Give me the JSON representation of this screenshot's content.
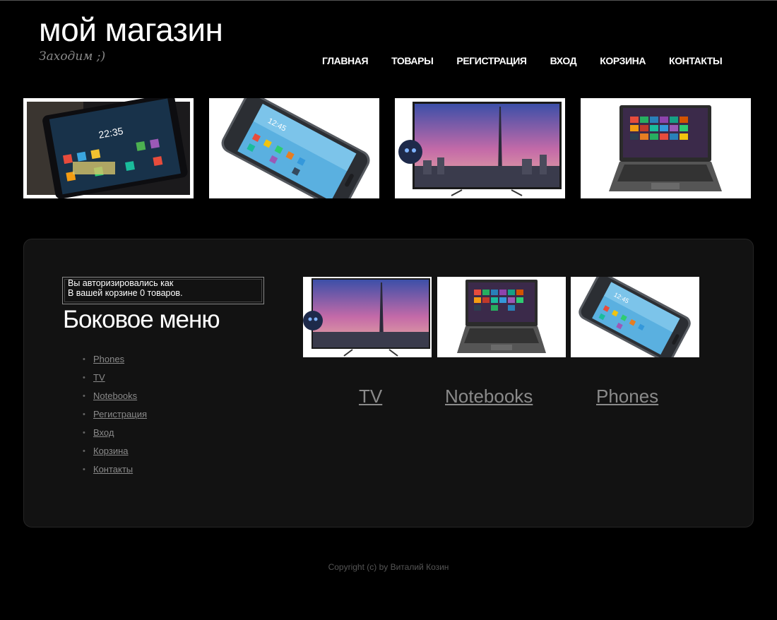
{
  "header": {
    "logo": "мой магазин",
    "slogan": "Заходим ;)"
  },
  "nav": [
    "ГЛАВНАЯ",
    "ТОВАРЫ",
    "РЕГИСТРАЦИЯ",
    "ВХОД",
    "КОРЗИНА",
    "КОНТАКТЫ"
  ],
  "banners": [
    "phone-dark-image",
    "smartphone-image",
    "tv-image",
    "laptop-image"
  ],
  "auth": {
    "line1": "Вы авторизировались как",
    "line2": "В вашей корзине 0 товаров."
  },
  "sidebar": {
    "title": "Боковое меню",
    "items": [
      "Phones",
      "TV",
      "Notebooks",
      "Регистрация",
      "Вход",
      "Корзина",
      "Контакты"
    ]
  },
  "categories": [
    {
      "label": "TV",
      "image": "tv-image"
    },
    {
      "label": "Notebooks",
      "image": "laptop-image"
    },
    {
      "label": "Phones",
      "image": "smartphone-image"
    }
  ],
  "footer": "Copyright (c) by Виталий Козин",
  "colors": {
    "background": "#000000",
    "panel": "#121212",
    "link": "#8a8a8a"
  }
}
